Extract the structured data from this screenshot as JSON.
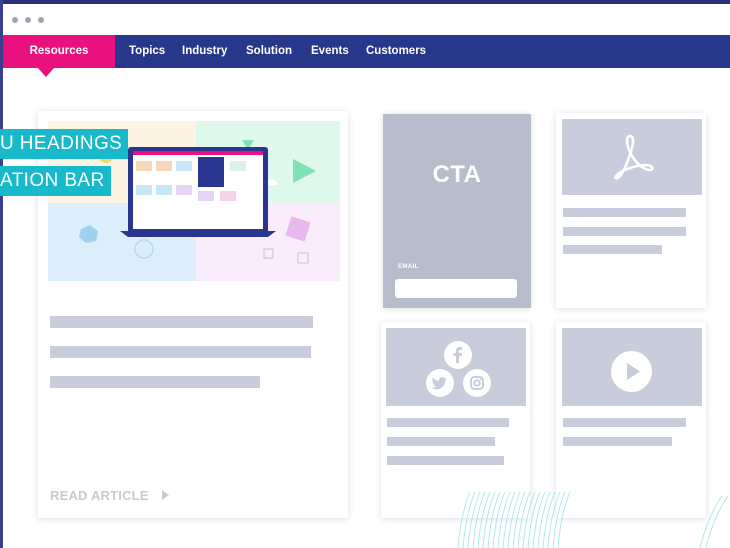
{
  "nav": {
    "items": [
      {
        "label": "Resources",
        "active": true
      },
      {
        "label": "Topics"
      },
      {
        "label": "Industry"
      },
      {
        "label": "Solution"
      },
      {
        "label": "Events"
      },
      {
        "label": "Customers"
      }
    ]
  },
  "callouts": {
    "line1": "U HEADINGS",
    "line2": "ATION BAR"
  },
  "article": {
    "read_more": "READ ARTICLE"
  },
  "cta": {
    "title": "CTA",
    "email_label": "EMAIL",
    "email_value": ""
  },
  "icons": {
    "pdf": "pdf-icon",
    "facebook": "facebook-icon",
    "twitter": "twitter-icon",
    "instagram": "instagram-icon",
    "play": "play-icon"
  },
  "colors": {
    "nav_bg": "#27378a",
    "accent": "#e8117d",
    "callout": "#19b9cc",
    "placeholder": "#c8ccdb"
  }
}
